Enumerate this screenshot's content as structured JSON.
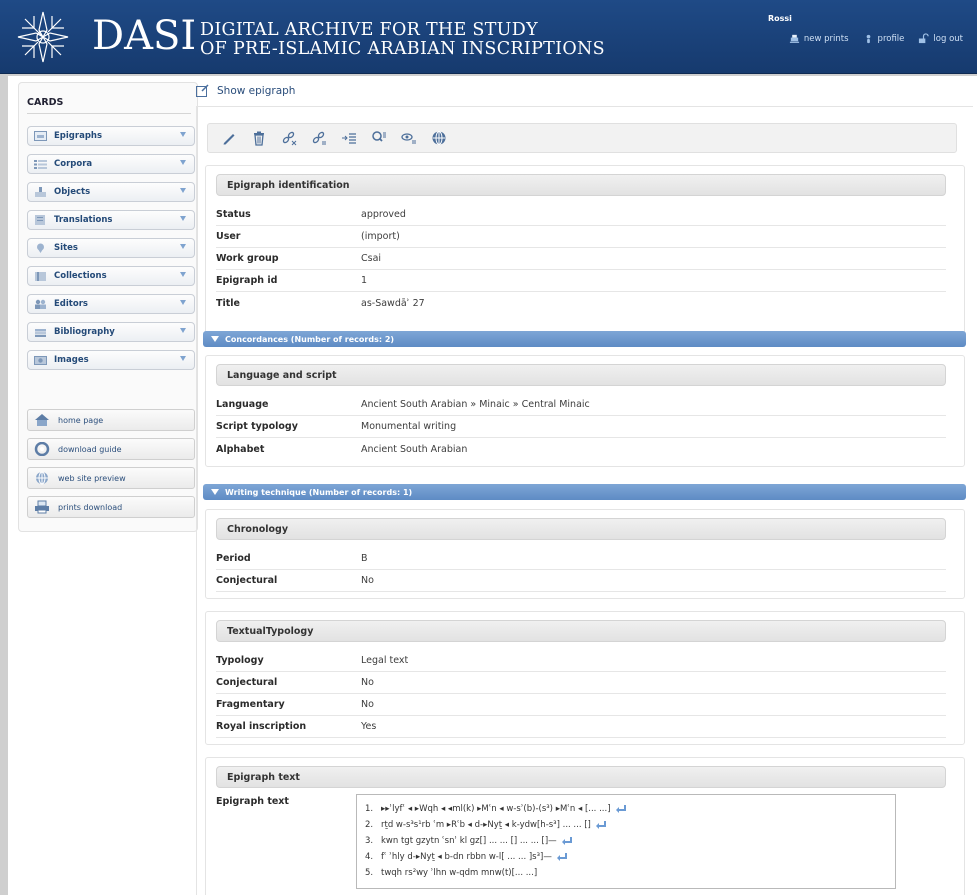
{
  "header": {
    "logo_text": "DASI",
    "subtitle_line1": "DIGITAL ARCHIVE FOR THE STUDY",
    "subtitle_line2": "OF PRE-ISLAMIC ARABIAN INSCRIPTIONS",
    "user": "Rossi",
    "links": [
      {
        "label": "new prints",
        "icon": "print-icon"
      },
      {
        "label": "profile",
        "icon": "user-icon"
      },
      {
        "label": "log out",
        "icon": "logout-icon"
      }
    ]
  },
  "sidebar": {
    "title": "CARDS",
    "cards": [
      {
        "label": "Epigraphs",
        "icon": "epigraph-icon"
      },
      {
        "label": "Corpora",
        "icon": "corpora-icon"
      },
      {
        "label": "Objects",
        "icon": "object-icon"
      },
      {
        "label": "Translations",
        "icon": "translation-icon"
      },
      {
        "label": "Sites",
        "icon": "site-icon"
      },
      {
        "label": "Collections",
        "icon": "collection-icon"
      },
      {
        "label": "Editors",
        "icon": "editors-icon"
      },
      {
        "label": "Bibliography",
        "icon": "bibliography-icon"
      },
      {
        "label": "Images",
        "icon": "image-icon"
      }
    ],
    "buttons": [
      {
        "label": "home page",
        "icon": "home-icon"
      },
      {
        "label": "download guide",
        "icon": "guide-icon"
      },
      {
        "label": "web site preview",
        "icon": "globe-icon"
      },
      {
        "label": "prints download",
        "icon": "printer-icon"
      }
    ]
  },
  "main": {
    "title": "Show epigraph",
    "toolbar": [
      "edit-icon",
      "delete-icon",
      "unlink-icon",
      "link-list-icon",
      "list-icon",
      "search-list-icon",
      "view-list-icon",
      "globe-icon"
    ],
    "identification": {
      "heading": "Epigraph identification",
      "rows": [
        {
          "label": "Status",
          "value": "approved"
        },
        {
          "label": "User",
          "value": "(import)"
        },
        {
          "label": "Work group",
          "value": "Csai"
        },
        {
          "label": "Epigraph id",
          "value": "1"
        },
        {
          "label": "Title",
          "value": "as-Sawdāʾ 27"
        }
      ]
    },
    "concordances_bar": "Concordances (Number of records: 2)",
    "language": {
      "heading": "Language and script",
      "rows": [
        {
          "label": "Language",
          "value": "Ancient South Arabian » Minaic » Central Minaic"
        },
        {
          "label": "Script typology",
          "value": "Monumental writing"
        },
        {
          "label": "Alphabet",
          "value": "Ancient South Arabian"
        }
      ]
    },
    "writing_bar": "Writing technique (Number of records: 1)",
    "chronology": {
      "heading": "Chronology",
      "rows": [
        {
          "label": "Period",
          "value": "B"
        },
        {
          "label": "Conjectural",
          "value": "No"
        }
      ]
    },
    "typology": {
      "heading": "TextualTypology",
      "rows": [
        {
          "label": "Typology",
          "value": "Legal text"
        },
        {
          "label": "Conjectural",
          "value": "No"
        },
        {
          "label": "Fragmentary",
          "value": "No"
        },
        {
          "label": "Royal inscription",
          "value": "Yes"
        }
      ]
    },
    "text": {
      "heading": "Epigraph text",
      "label": "Epigraph text",
      "lines": [
        {
          "n": "1.",
          "t": "▸▸ʾlyfʿ ◂ ▸Wqh ◂ ◂ml(k) ▸Mʿn ◂ w-sʾ(b)-(s³) ▸Mʿn ◂ [... ...]"
        },
        {
          "n": "2.",
          "t": "rṯd w-s³s¹rb ʿm ▸Rʿb ◂ d-▸Nyṯ ◂ k-ydw[h-s³] ... ... []"
        },
        {
          "n": "3.",
          "t": "kwn tgt gzytn ʿsnʾ kl gz[] ... ... [] ... ... []—"
        },
        {
          "n": "4.",
          "t": "fʿ ʾhly d-▸Nyṯ ◂ b-dn rbbn w-l[ ... ... ]s³]—"
        },
        {
          "n": "5.",
          "t": "twqh rs²wy ʾlhn w-qdm mnw(t)[... ...]"
        }
      ]
    }
  }
}
